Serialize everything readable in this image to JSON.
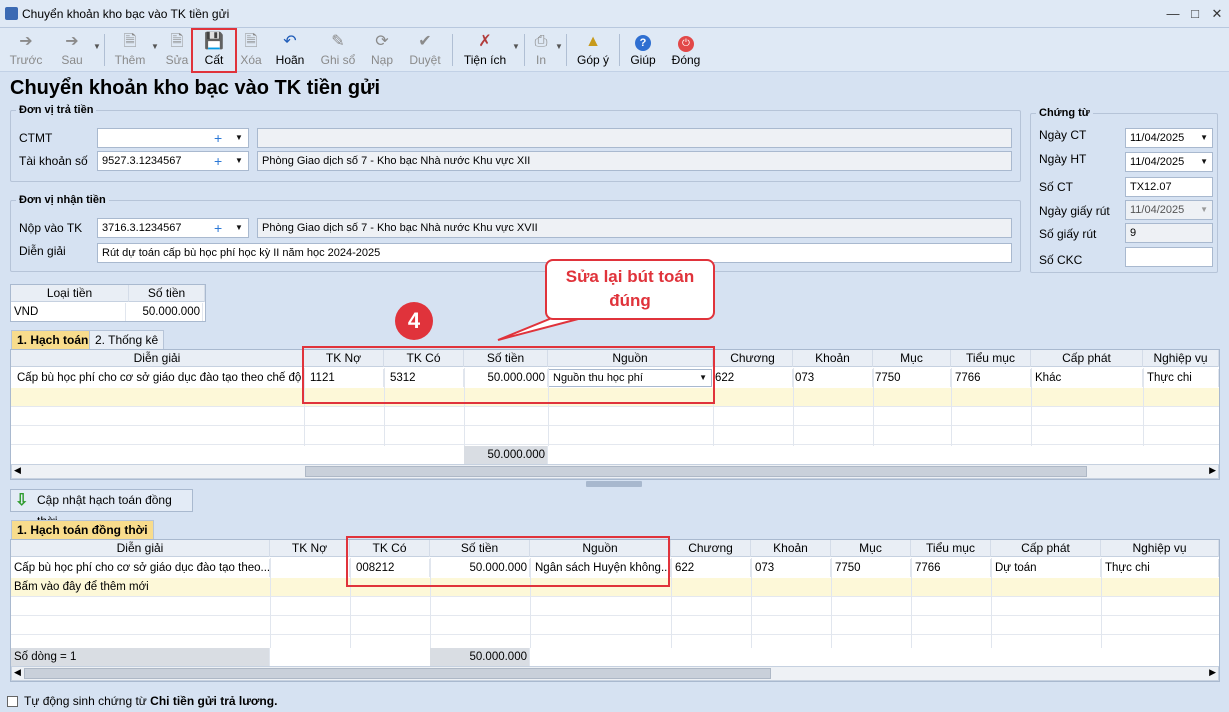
{
  "window": {
    "title": "Chuyển khoản kho bạc vào TK tiền gửi"
  },
  "toolbar": {
    "prev": "Trước",
    "next": "Sau",
    "add": "Thêm",
    "edit": "Sửa",
    "save": "Cất",
    "delete": "Xóa",
    "undo": "Hoãn",
    "post": "Ghi sổ",
    "load": "Nạp",
    "approve": "Duyệt",
    "utilities": "Tiện ích",
    "print": "In",
    "feedback": "Góp ý",
    "help": "Giúp",
    "close": "Đóng"
  },
  "page_title": "Chuyển khoản kho bạc vào TK tiền gửi",
  "payer": {
    "title": "Đơn vị trả tiền",
    "ctmt_label": "CTMT",
    "ctmt_value": "",
    "ctmt_desc": "",
    "account_label": "Tài khoản số",
    "account_value": "9527.3.1234567",
    "account_desc": "Phòng Giao dịch số 7 - Kho bạc Nhà nước Khu vực XII"
  },
  "receiver": {
    "title": "Đơn vị nhận tiền",
    "deposit_label": "Nộp vào TK",
    "deposit_value": "3716.3.1234567",
    "deposit_desc": "Phòng Giao dịch số 7 - Kho bạc Nhà nước Khu vực XVII",
    "memo_label": "Diễn giải",
    "memo_value": "Rút dự toán cấp bù học phí học kỳ II năm học 2024-2025"
  },
  "voucher": {
    "title": "Chứng từ",
    "date_ct_label": "Ngày CT",
    "date_ct": "11/04/2025",
    "date_ht_label": "Ngày HT",
    "date_ht": "11/04/2025",
    "no_ct_label": "Số CT",
    "no_ct": "TX12.07",
    "withdraw_date_label": "Ngày giấy rút",
    "withdraw_date": "11/04/2025",
    "withdraw_no_label": "Số giấy rút",
    "withdraw_no": "9",
    "ckc_label": "Số CKC",
    "ckc": ""
  },
  "currency": {
    "col1": "Loại tiền",
    "col2": "Số tiền",
    "type": "VND",
    "amount": "50.000.000"
  },
  "tabs": {
    "t1": "1. Hạch toán",
    "t2": "2. Thống kê"
  },
  "grid1": {
    "headers": [
      "Diễn giải",
      "TK Nợ",
      "TK Có",
      "Số tiền",
      "Nguồn",
      "Chương",
      "Khoản",
      "Mục",
      "Tiểu mục",
      "Cấp phát",
      "Nghiệp vụ"
    ],
    "row": [
      "Cấp bù học phí cho cơ sở giáo dục đào tạo theo chế độ",
      "1121",
      "5312",
      "50.000.000",
      "Nguồn thu học phí",
      "622",
      "073",
      "7750",
      "7766",
      "Khác",
      "Thực chi"
    ],
    "total": "50.000.000"
  },
  "annotation": {
    "step": "4",
    "callout": "Sửa lại bút toán đúng"
  },
  "update_button": "Cập nhật hạch toán đồng thời",
  "tab2": "1. Hạch toán đồng thời",
  "grid2": {
    "headers": [
      "Diễn giải",
      "TK Nợ",
      "TK Có",
      "Số tiền",
      "Nguồn",
      "Chương",
      "Khoản",
      "Mục",
      "Tiểu mục",
      "Cấp phát",
      "Nghiệp vụ"
    ],
    "row": [
      "Cấp bù học phí cho cơ sở giáo dục đào tạo theo...",
      "",
      "008212",
      "50.000.000",
      "Ngân sách Huyện không...",
      "622",
      "073",
      "7750",
      "7766",
      "Dự toán",
      "Thực chi"
    ],
    "add_hint": "Bấm vào đây để thêm mới",
    "row_count": "Số dòng = 1",
    "total": "50.000.000"
  },
  "footer": {
    "prefix": "Tự động sinh chứng từ ",
    "bold": "Chi tiền gửi trả lương."
  },
  "colors": {
    "accent_red": "#e0333b",
    "tab_active": "#f8dc8c",
    "bg": "#d6e2f2"
  }
}
